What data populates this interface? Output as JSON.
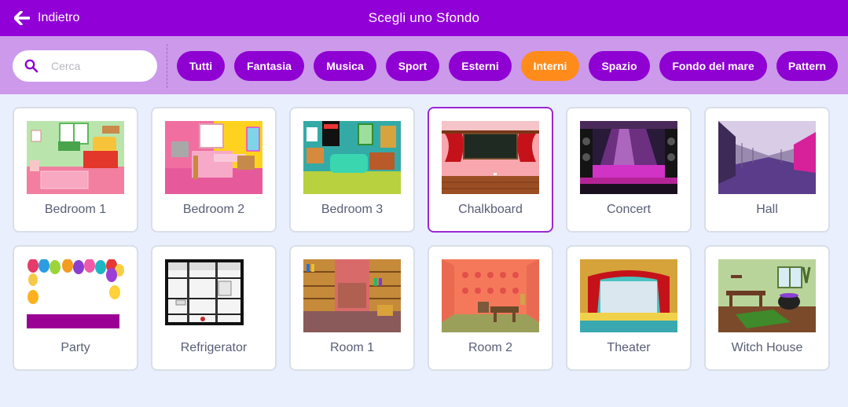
{
  "header": {
    "back_label": "Indietro",
    "title": "Scegli uno Sfondo"
  },
  "search": {
    "placeholder": "Cerca",
    "value": ""
  },
  "tags": [
    {
      "label": "Tutti",
      "active": false
    },
    {
      "label": "Fantasia",
      "active": false
    },
    {
      "label": "Musica",
      "active": false
    },
    {
      "label": "Sport",
      "active": false
    },
    {
      "label": "Esterni",
      "active": false
    },
    {
      "label": "Interni",
      "active": true
    },
    {
      "label": "Spazio",
      "active": false
    },
    {
      "label": "Fondo del mare",
      "active": false
    },
    {
      "label": "Pattern",
      "active": false
    }
  ],
  "backdrops": [
    {
      "name": "Bedroom 1",
      "selected": false
    },
    {
      "name": "Bedroom 2",
      "selected": false
    },
    {
      "name": "Bedroom 3",
      "selected": false
    },
    {
      "name": "Chalkboard",
      "selected": true
    },
    {
      "name": "Concert",
      "selected": false
    },
    {
      "name": "Hall",
      "selected": false
    },
    {
      "name": "Party",
      "selected": false
    },
    {
      "name": "Refrigerator",
      "selected": false
    },
    {
      "name": "Room 1",
      "selected": false
    },
    {
      "name": "Room 2",
      "selected": false
    },
    {
      "name": "Theater",
      "selected": false
    },
    {
      "name": "Witch House",
      "selected": false
    }
  ],
  "colors": {
    "header": "#9100d6",
    "filterbar": "#cc99eb",
    "tag": "#8f00d2",
    "tag_active": "#ff8c1a",
    "selected_border": "#9c27d4"
  }
}
